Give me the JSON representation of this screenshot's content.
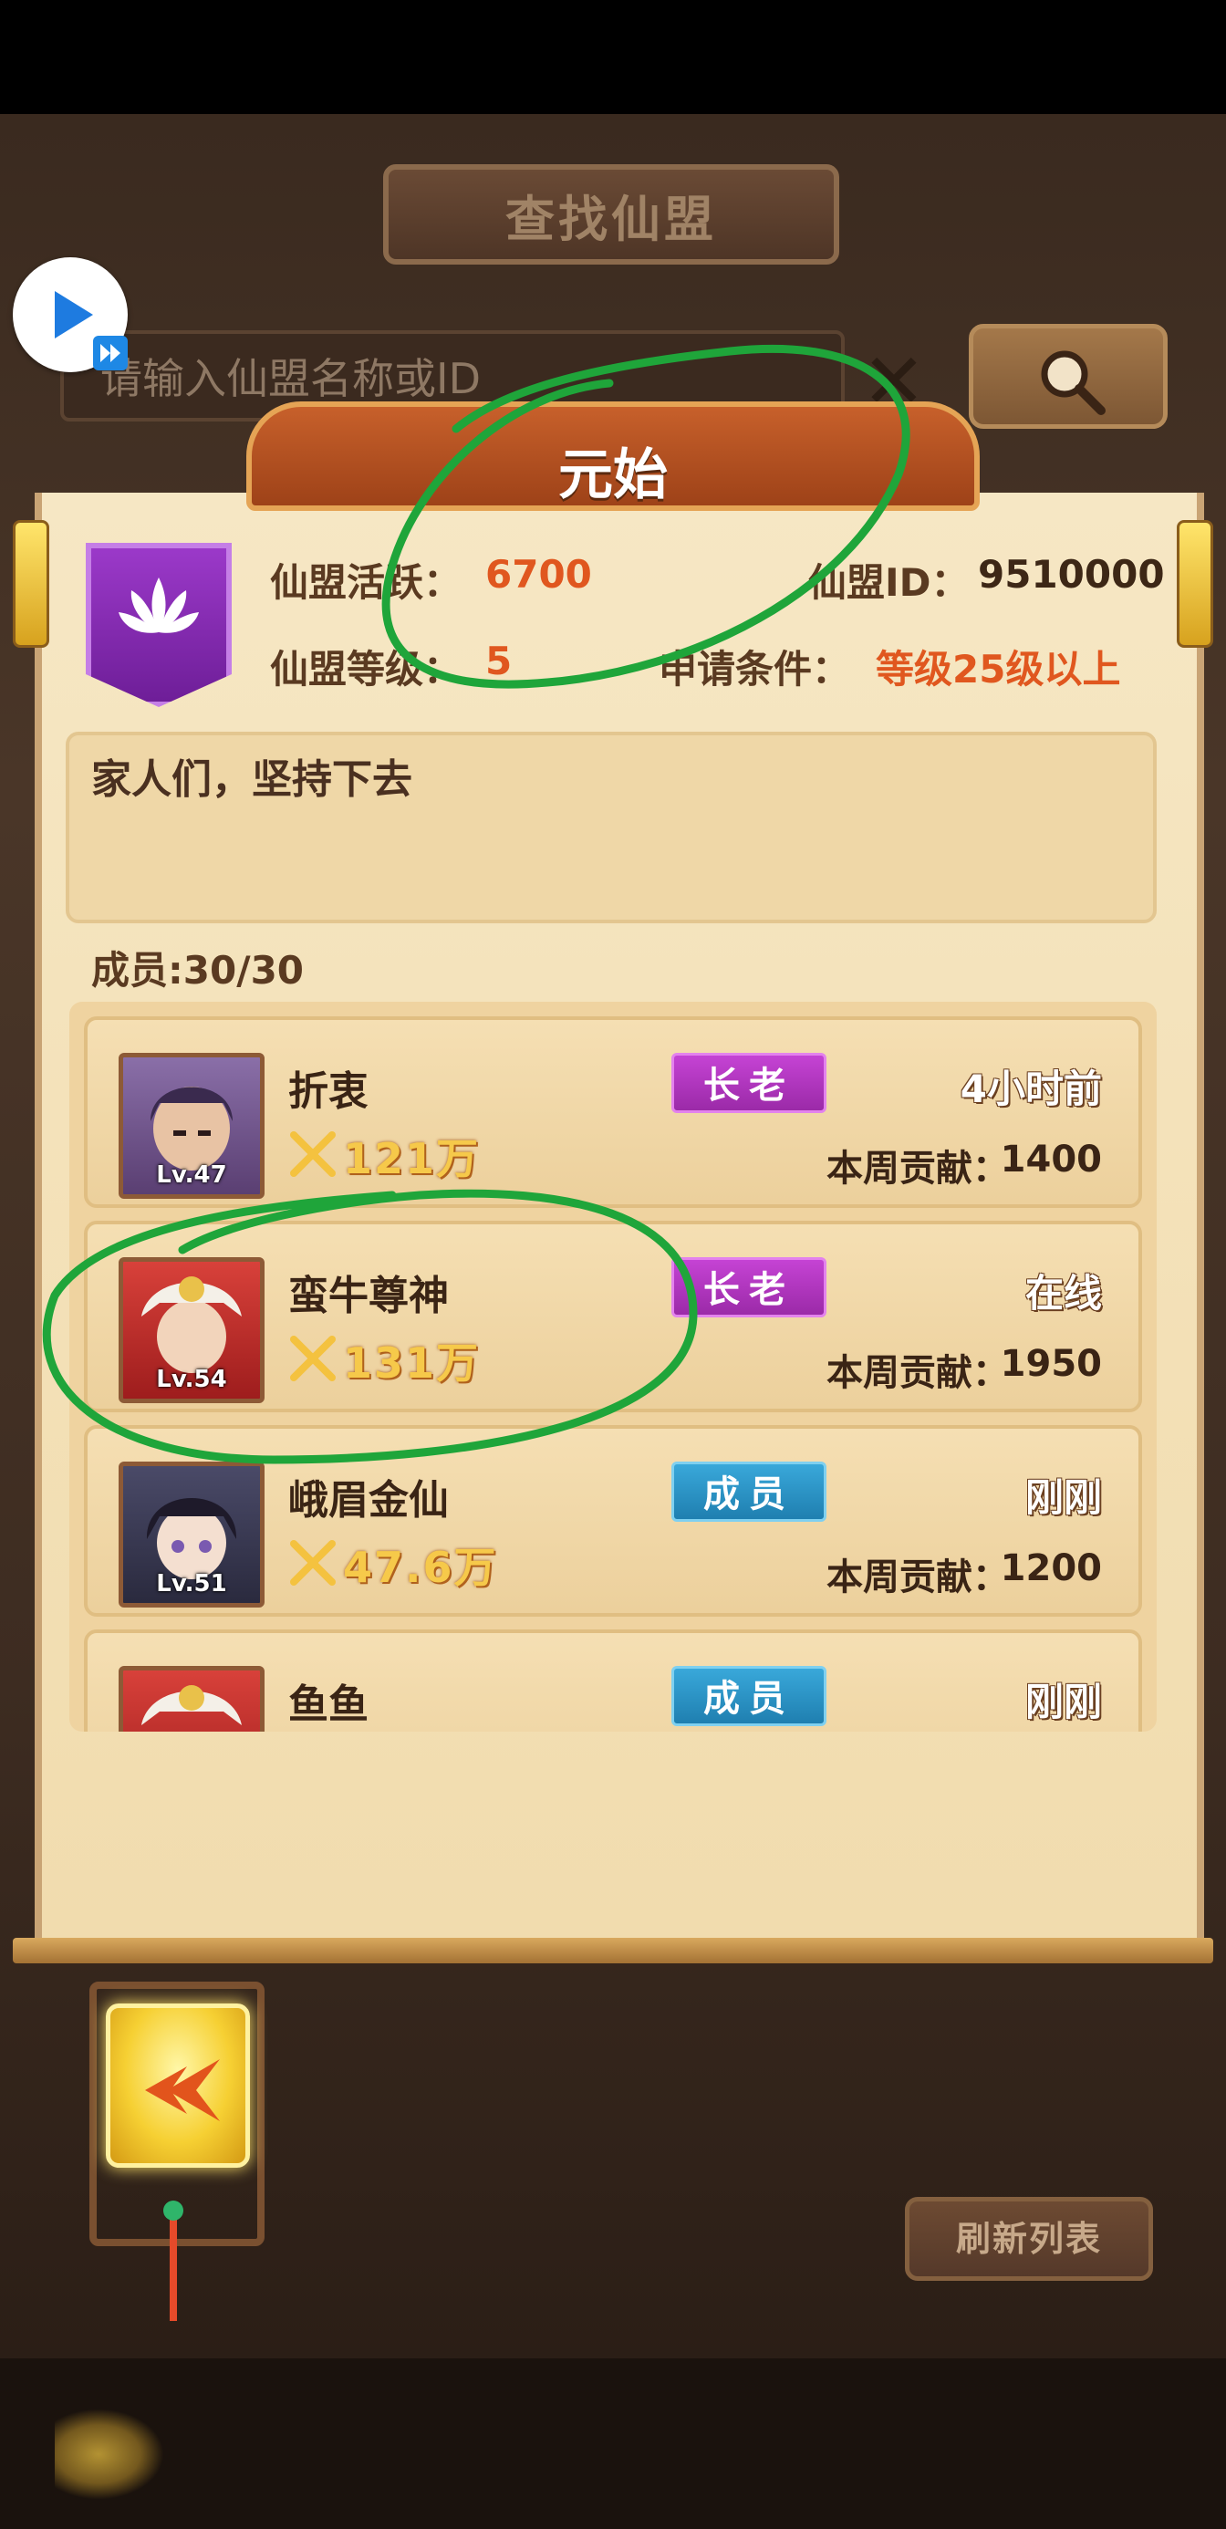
{
  "header": {
    "title": "查找仙盟"
  },
  "search": {
    "placeholder": "请输入仙盟名称或ID"
  },
  "guild": {
    "name": "元始",
    "activity_label": "仙盟活跃：",
    "activity_value": "6700",
    "id_label": "仙盟ID：",
    "id_value": "9510000",
    "level_label": "仙盟等级：",
    "level_value": "5",
    "requirement_label": "申请条件：",
    "requirement_value": "等级25级以上",
    "notice": "家人们，坚持下去",
    "member_count": "成员:30/30"
  },
  "members": [
    {
      "name": "折衷",
      "level": "Lv.47",
      "power": "121万",
      "rank": "长老",
      "rank_type": "elder",
      "status": "4小时前",
      "contrib_label": "本周贡献：",
      "contrib": "1400"
    },
    {
      "name": "蛮牛尊神",
      "level": "Lv.54",
      "power": "131万",
      "rank": "长老",
      "rank_type": "elder",
      "status": "在线",
      "contrib_label": "本周贡献：",
      "contrib": "1950"
    },
    {
      "name": "峨眉金仙",
      "level": "Lv.51",
      "power": "47.6万",
      "rank": "成员",
      "rank_type": "member",
      "status": "刚刚",
      "contrib_label": "本周贡献：",
      "contrib": "1200"
    },
    {
      "name": "鱼鱼",
      "level": "",
      "power": "",
      "rank": "成员",
      "rank_type": "member",
      "status": "刚刚",
      "contrib_label": "",
      "contrib": ""
    }
  ],
  "footer": {
    "refresh_label": "刷新列表"
  },
  "colors": {
    "accent_orange": "#e0571f",
    "elder_purple": "#b53bc4",
    "member_blue": "#2b93c6",
    "annotation_green": "#1fa53a"
  }
}
